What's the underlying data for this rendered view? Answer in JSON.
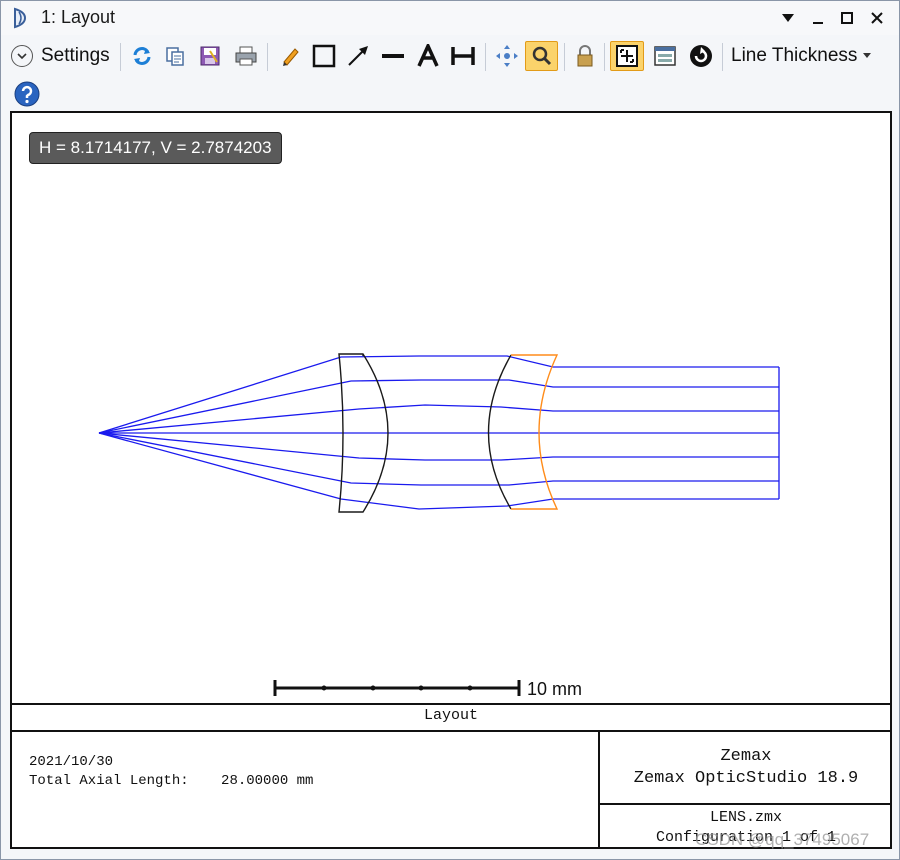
{
  "window": {
    "title": "1: Layout"
  },
  "toolbar": {
    "settings_label": "Settings",
    "line_thickness_label": "Line Thickness"
  },
  "plot": {
    "cursor_readout": "H = 8.1714177, V = 2.7874203",
    "scale_bar_label": "10 mm"
  },
  "footer": {
    "title": "Layout",
    "date": "2021/10/30",
    "total_axial_length_label": "Total Axial Length:",
    "total_axial_length_value": "28.00000 mm",
    "company": "Zemax",
    "product": "Zemax OpticStudio 18.9",
    "file": "LENS.zmx",
    "configuration": "Configuration 1 of 1"
  },
  "watermark": "CSDN @qq_37495067",
  "colors": {
    "rays": "#1a1aee",
    "lens1": "#1a1a1a",
    "lens2": "#ff8c1a",
    "toolbar_active": "#fbd36b"
  }
}
